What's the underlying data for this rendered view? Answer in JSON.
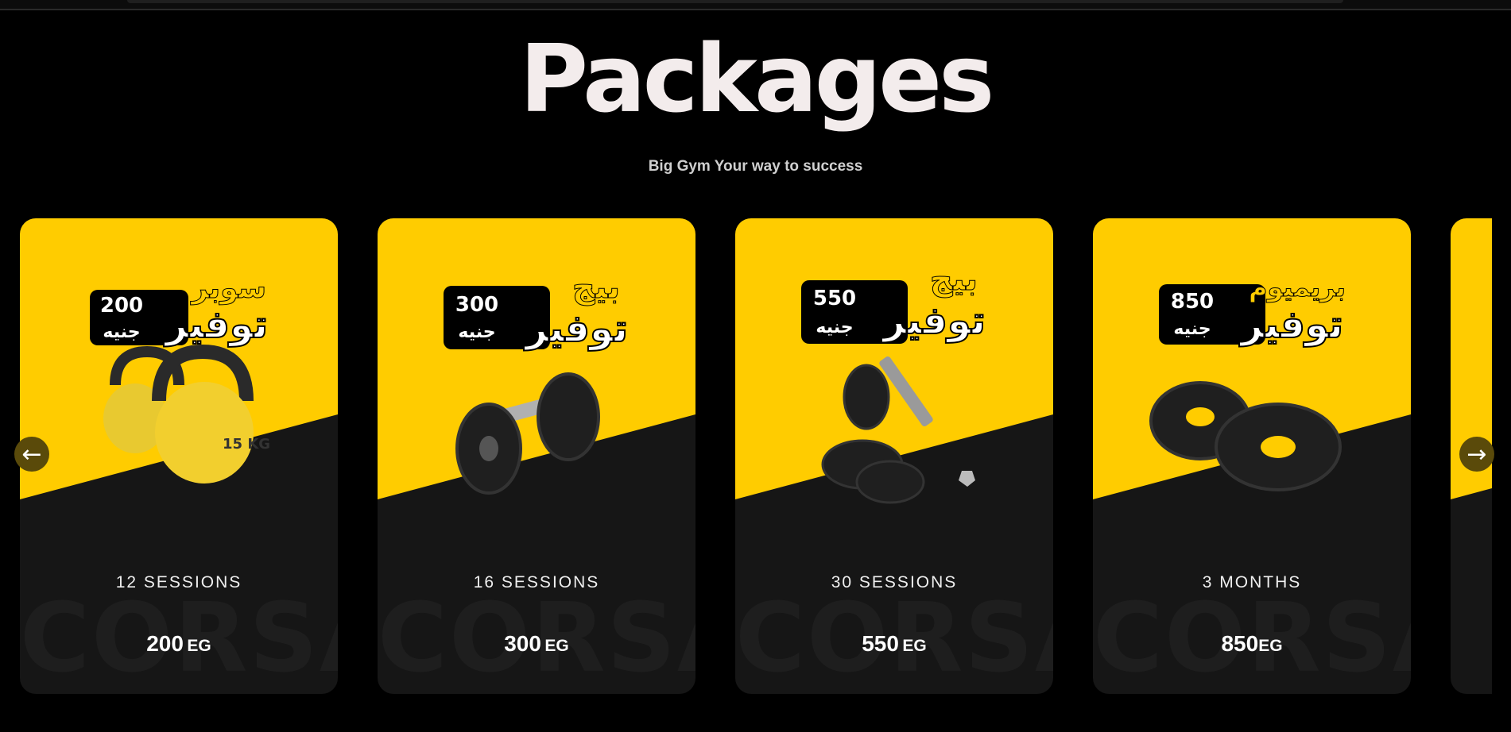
{
  "section": {
    "title": "Packages",
    "subtitle": "Big Gym Your way to success",
    "ghost_text": "CORSA"
  },
  "colors": {
    "accent": "#ffcc00",
    "card_bg": "#161616",
    "page_bg": "#000000"
  },
  "packages": [
    {
      "badge_top": "سوبر",
      "badge_bottom": "توفير",
      "badge_price": "200",
      "badge_currency": "جنيه",
      "product": "kettlebell",
      "product_mark": "15 KG",
      "title": "12 SESSIONS",
      "price": "200",
      "currency": "EG"
    },
    {
      "badge_top": "بيج",
      "badge_bottom": "توفير",
      "badge_price": "300",
      "badge_currency": "جنيه",
      "product": "dumbbell",
      "title": "16 SESSIONS",
      "price": "300",
      "currency": "EG"
    },
    {
      "badge_top": "بيج",
      "badge_bottom": "توفير",
      "badge_price": "550",
      "badge_currency": "جنيه",
      "product": "dumbbell-kit",
      "title": "30 SESSIONS",
      "price": "550",
      "currency": "EG"
    },
    {
      "badge_top": "بريميوم",
      "badge_bottom": "توفير",
      "badge_price": "850",
      "badge_currency": "جنيه",
      "product": "weight-plates",
      "title": "3 MONTHS",
      "price": "850",
      "currency": "EG"
    }
  ],
  "nav": {
    "prev_icon": "←",
    "next_icon": "→"
  }
}
